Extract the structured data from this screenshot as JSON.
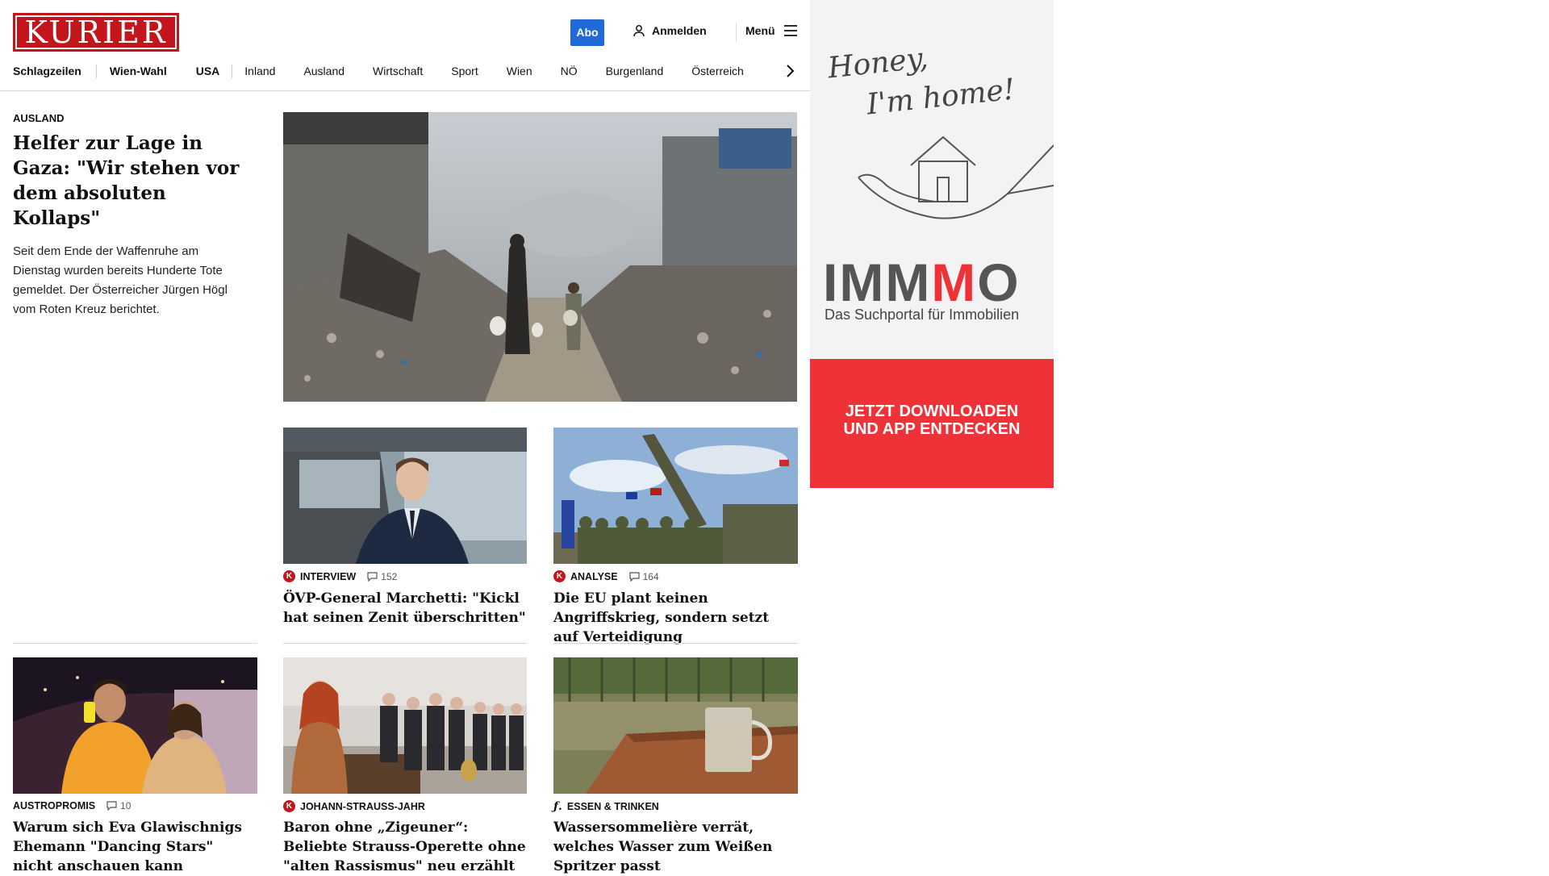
{
  "header": {
    "logo": "KURIER",
    "abo_label": "Abo",
    "login_label": "Anmelden",
    "menu_label": "Menü"
  },
  "nav": {
    "items": [
      "Schlagzeilen",
      "Wien-Wahl",
      "USA",
      "Inland",
      "Ausland",
      "Wirtschaft",
      "Sport",
      "Wien",
      "NÖ",
      "Burgenland",
      "Österreich"
    ]
  },
  "lead": {
    "kicker": "AUSLAND",
    "headline": "Helfer zur Lage in Gaza: \"Wir stehen vor dem absoluten Kollaps\"",
    "teaser": "Seit dem Ende der Waffenruhe am Dienstag wurden bereits Hunderte Tote gemeldet. Der Österreicher Jürgen Högl vom Roten Kreuz berichtet."
  },
  "articles": [
    {
      "kicker": "INTERVIEW",
      "comments": "152",
      "headline": "ÖVP-General Marchetti: \"Kickl hat seinen Zenit überschritten\"",
      "badge": "K"
    },
    {
      "kicker": "ANALYSE",
      "comments": "164",
      "headline": "Die EU plant keinen Angriffskrieg, sondern setzt auf Verteidigung",
      "badge": "K"
    },
    {
      "kicker": "AUSTROPROMIS",
      "comments": "10",
      "headline": "Warum sich Eva Glawischnigs Ehemann \"Dancing Stars\" nicht anschauen kann"
    },
    {
      "kicker": "JOHANN-STRAUSS-JAHR",
      "headline": "Baron ohne „Zigeuner“: Beliebte Strauss-Operette ohne \"alten Rassismus\" neu erzählt",
      "badge": "K"
    },
    {
      "kicker": "ESSEN & TRINKEN",
      "headline": "Wassersommelière verrät, welches Wasser zum Weißen Spritzer passt"
    }
  ],
  "ad": {
    "script_line1": "Honey,",
    "script_line2": "I'm home!",
    "brand_a": "IMM",
    "brand_m": "M",
    "brand_b": "O",
    "brand_full": "IMMMO",
    "tagline": "Das Suchportal für Immobilien",
    "cta_line1": "JETZT DOWNLOADEN",
    "cta_line2": "UND APP ENTDECKEN"
  },
  "colors": {
    "brand_red": "#c3161c",
    "abo_blue": "#1f6ad8",
    "ad_red": "#ee3237"
  }
}
